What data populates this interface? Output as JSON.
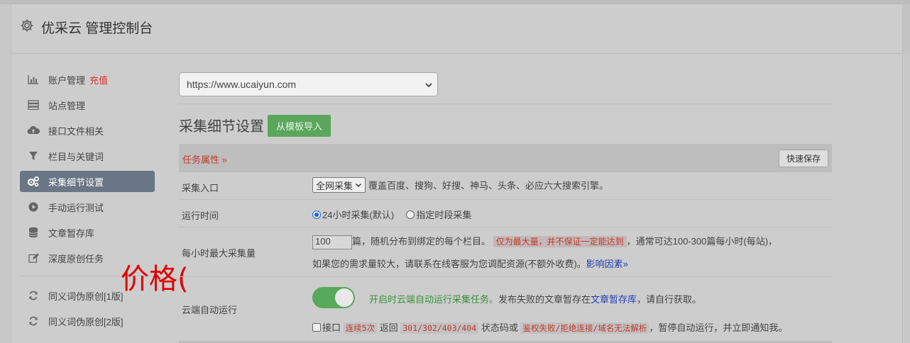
{
  "header": {
    "title": "优采云 管理控制台",
    "icon": "gear-icon"
  },
  "sidebar": {
    "items": [
      {
        "label": "账户管理",
        "tag": "充值",
        "icon": "bar-chart-icon"
      },
      {
        "label": "站点管理",
        "icon": "server-icon"
      },
      {
        "label": "接口文件相关",
        "icon": "cloud-upload-icon"
      },
      {
        "label": "栏目与关键词",
        "icon": "filter-icon"
      },
      {
        "label": "采集细节设置",
        "icon": "cogs-icon",
        "active": true
      },
      {
        "label": "手动运行测试",
        "icon": "play-circle-icon"
      },
      {
        "label": "文章暂存库",
        "icon": "database-icon"
      },
      {
        "label": "深度原创任务",
        "icon": "edit-icon"
      },
      {
        "label": "同义词伪原创[1版]",
        "icon": "refresh-icon"
      },
      {
        "label": "同义词伪原创[2版]",
        "icon": "refresh-icon"
      }
    ]
  },
  "overlay": {
    "text": "价格("
  },
  "main": {
    "site_select": {
      "value": "https://www.ucaiyun.com"
    },
    "section_title": "采集细节设置",
    "import_button": "从模板导入",
    "tasks_label": "任务属性 »",
    "save_button": "快速保存",
    "rows": {
      "entry": {
        "label": "采集入口",
        "select_value": "全网采集",
        "desc": "覆盖百度、搜狗、好搜、神马、头条、必应六大搜索引擎。"
      },
      "runtime": {
        "label": "运行时间",
        "option1": "24小时采集(默认)",
        "option2": "指定时段采集"
      },
      "max_per_hour": {
        "label": "每小时最大采集量",
        "value": "100",
        "text1": "篇，随机分布到绑定的每个栏目。",
        "warn": "仅为最大量，并不保证一定能达到",
        "text2": "，通常可达100-300篇每小时(每站)，",
        "text3": "如果您的需求量较大，请联系在线客服为您调配资源(不额外收费)。",
        "link": "影响因素»"
      },
      "cloud_auto": {
        "label": "云端自动运行",
        "green": "开启时云端自动运行采集任务。",
        "text1": "发布失败的文章暂存在",
        "link": "文章暂存库",
        "text2": "，请自行获取。",
        "check_label": "接口",
        "code1": "连续5次",
        "text3": "返回",
        "code2": "301/302/403/404",
        "text4": "状态码或",
        "code3": "鉴权失败/拒绝连接/域名无法解析",
        "text5": "，暂停自动运行，并立即通知我。"
      }
    }
  }
}
